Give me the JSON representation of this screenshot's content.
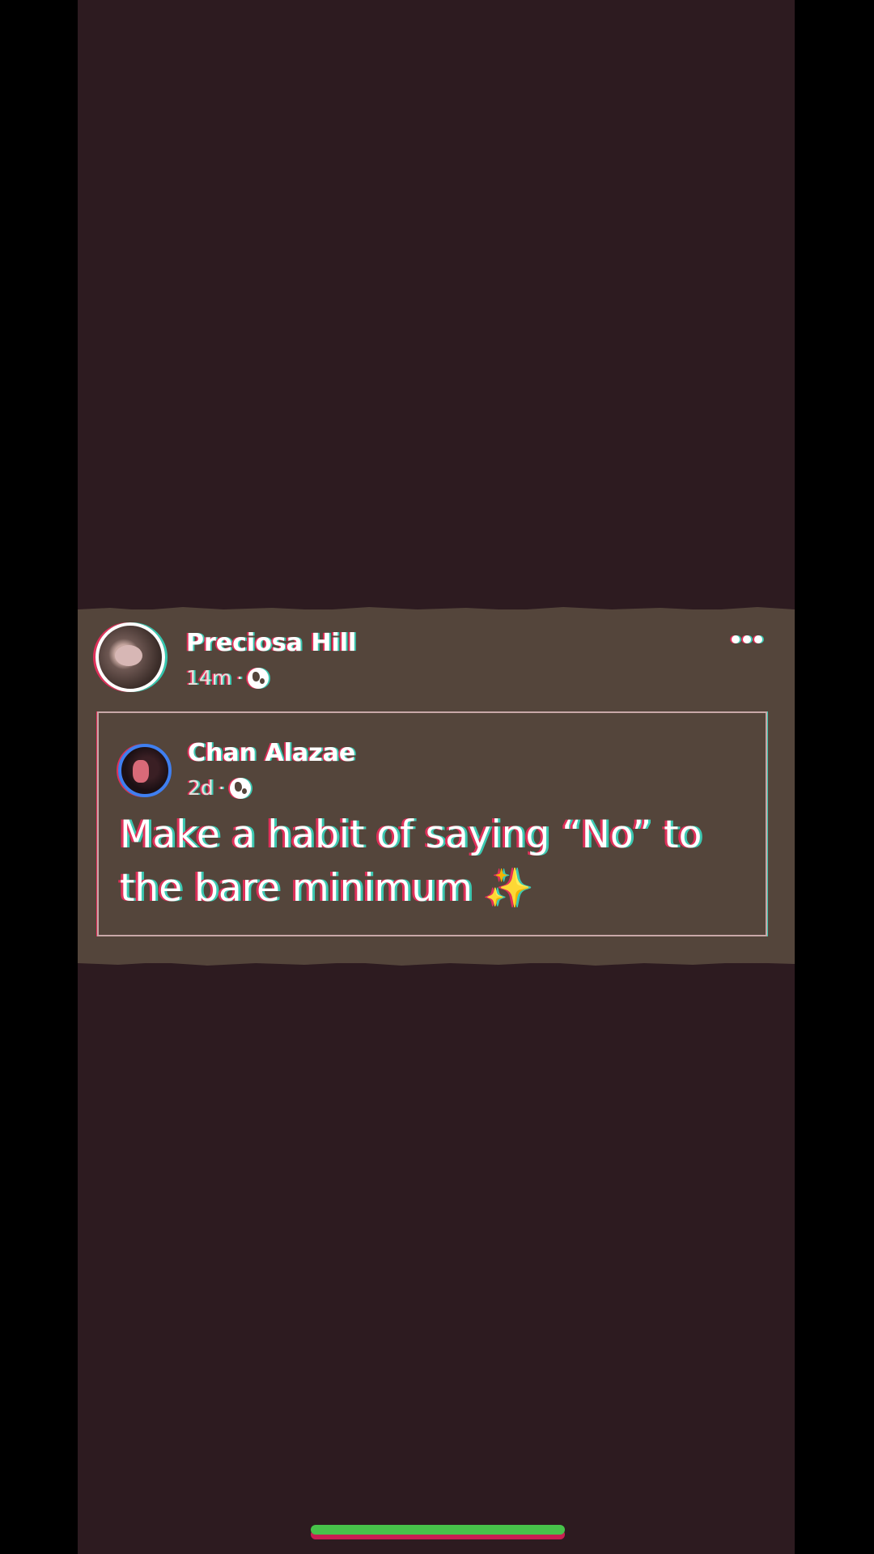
{
  "post": {
    "author_name": "Preciosa Hill",
    "time": "14m",
    "separator": "·",
    "privacy_icon": "globe-icon",
    "more_icon": "more-horizontal-icon",
    "shared": {
      "author_name": "Chan Alazae",
      "time": "2d",
      "separator": "·",
      "privacy_icon": "globe-icon",
      "text": "Make a habit of saying “No” to the bare minimum ✨"
    }
  },
  "colors": {
    "background": "#2d1b20",
    "card": "#54453b",
    "glitch_red": "#e0305a",
    "glitch_cyan": "#3cc9b2",
    "shared_avatar_ring": "#3f7ff0",
    "home_indicator": "#47c24a"
  }
}
